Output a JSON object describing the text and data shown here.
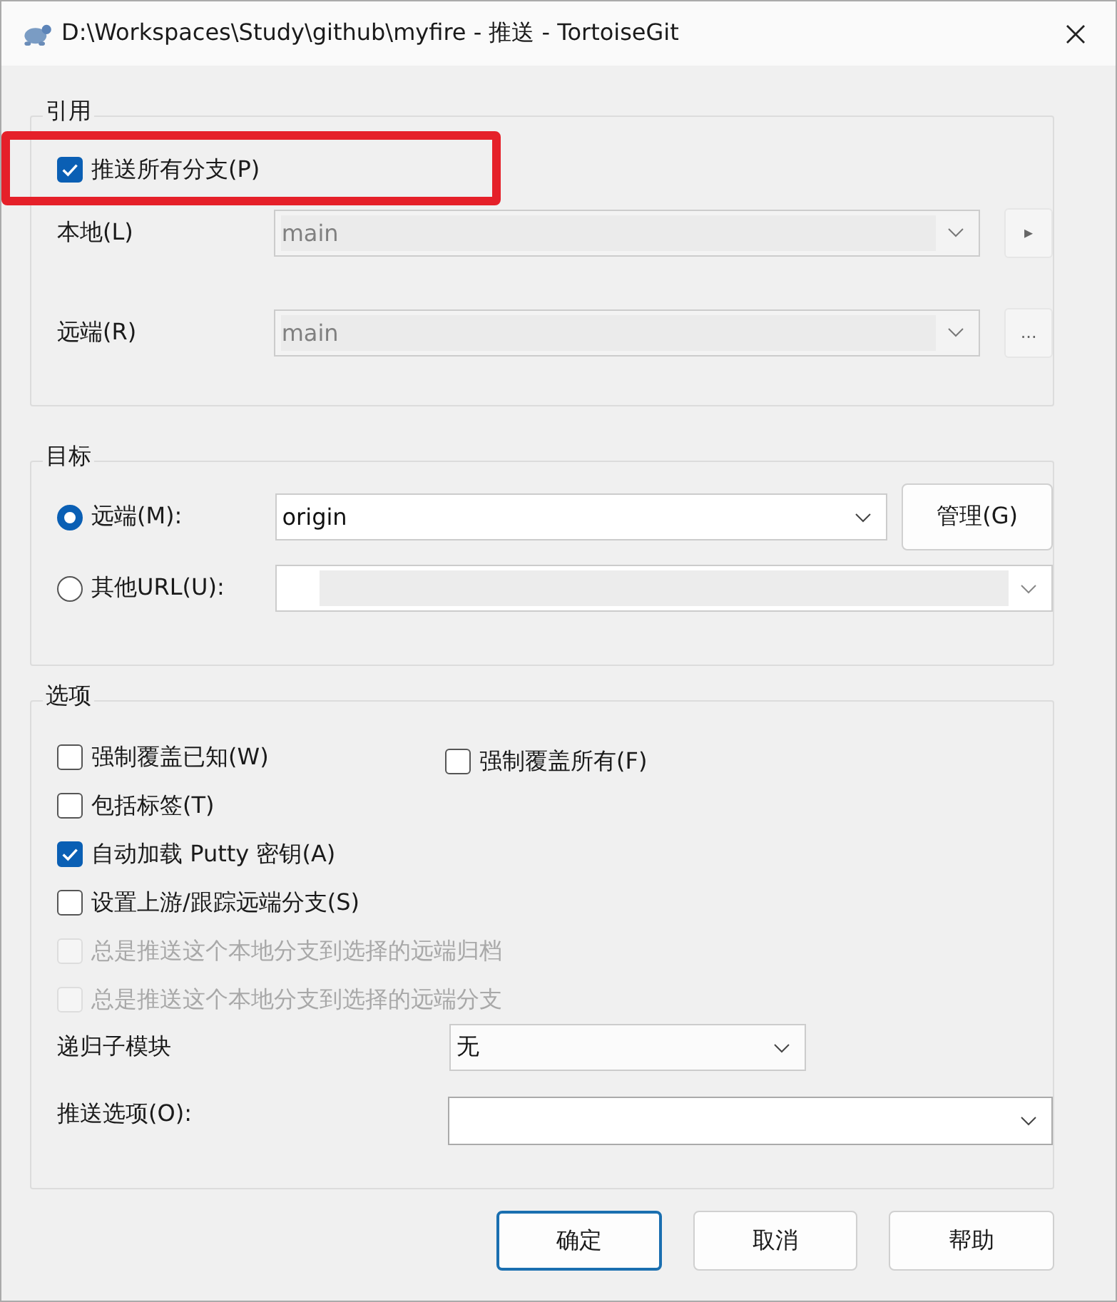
{
  "window": {
    "title": "D:\\Workspaces\\Study\\github\\myfire - 推送 - TortoiseGit"
  },
  "refs": {
    "legend": "引用",
    "push_all": {
      "label": "推送所有分支(P)",
      "checked": true,
      "highlighted": true
    },
    "local": {
      "label": "本地(L)",
      "value": "main",
      "disabled": true,
      "button": "▸"
    },
    "remote": {
      "label": "远端(R)",
      "value": "main",
      "disabled": true,
      "button": "..."
    }
  },
  "target": {
    "legend": "目标",
    "radios": [
      {
        "label": "远端(M):",
        "selected": true
      },
      {
        "label": "其他URL(U):",
        "selected": false
      }
    ],
    "remote_value": "origin",
    "manage_button": "管理(G)",
    "url_disabled": true
  },
  "options": {
    "legend": "选项",
    "checkbox_rows": [
      [
        {
          "label": "强制覆盖已知(W)",
          "checked": false,
          "disabled": false
        },
        {
          "label": "强制覆盖所有(F)",
          "checked": false,
          "disabled": false
        }
      ],
      [
        {
          "label": "包括标签(T)",
          "checked": false,
          "disabled": false
        }
      ],
      [
        {
          "label": "自动加载 Putty 密钥(A)",
          "checked": true,
          "disabled": false
        }
      ],
      [
        {
          "label": "设置上游/跟踪远端分支(S)",
          "checked": false,
          "disabled": false
        }
      ],
      [
        {
          "label": "总是推送这个本地分支到选择的远端归档",
          "checked": false,
          "disabled": true
        }
      ],
      [
        {
          "label": "总是推送这个本地分支到选择的远端分支",
          "checked": false,
          "disabled": true
        }
      ]
    ],
    "submodule": {
      "label": "递归子模块",
      "value": "无"
    },
    "push_option": {
      "label": "推送选项(O):"
    }
  },
  "buttons": [
    {
      "label": "确定",
      "default": true
    },
    {
      "label": "取消",
      "default": false
    },
    {
      "label": "帮助",
      "default": false
    }
  ]
}
